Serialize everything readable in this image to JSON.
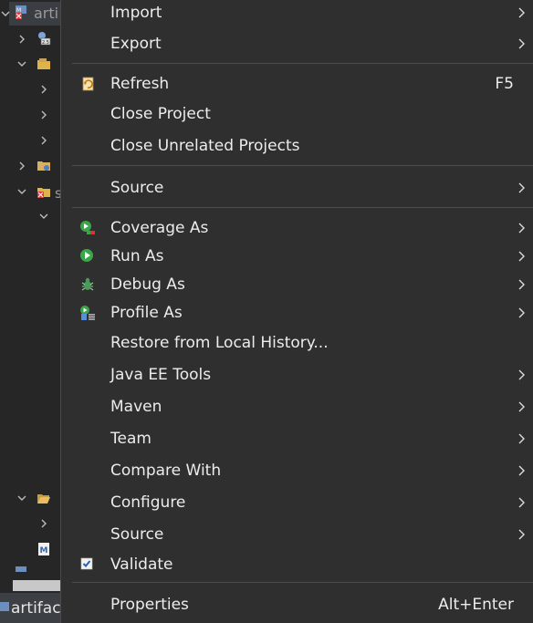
{
  "tree": {
    "rows": [
      {
        "label": "arti",
        "expanded": true
      },
      {
        "label": "",
        "expanded": false
      },
      {
        "label": "",
        "expanded": true
      },
      {
        "label": "",
        "expanded": false
      },
      {
        "label": "",
        "expanded": false
      },
      {
        "label": "",
        "expanded": false
      },
      {
        "label": "",
        "expanded": false
      },
      {
        "label": "",
        "expanded": true
      },
      {
        "label": "",
        "expanded": true
      },
      {
        "label": "",
        "expanded": true
      },
      {
        "label": "",
        "expanded": false
      }
    ],
    "status_label": "artifact"
  },
  "menu": {
    "items": [
      {
        "label": "Import",
        "accelerator": "",
        "submenu": true,
        "icon": ""
      },
      {
        "label": "Export",
        "accelerator": "",
        "submenu": true,
        "icon": ""
      },
      {
        "label": "Refresh",
        "accelerator": "F5",
        "submenu": false,
        "icon": "refresh-icon"
      },
      {
        "label": "Close Project",
        "accelerator": "",
        "submenu": false,
        "icon": ""
      },
      {
        "label": "Close Unrelated Projects",
        "accelerator": "",
        "submenu": false,
        "icon": ""
      },
      {
        "label": "Source",
        "accelerator": "",
        "submenu": true,
        "icon": ""
      },
      {
        "label": "Coverage As",
        "accelerator": "",
        "submenu": true,
        "icon": "coverage-icon"
      },
      {
        "label": "Run As",
        "accelerator": "",
        "submenu": true,
        "icon": "run-icon"
      },
      {
        "label": "Debug As",
        "accelerator": "",
        "submenu": true,
        "icon": "debug-bug-icon"
      },
      {
        "label": "Profile As",
        "accelerator": "",
        "submenu": true,
        "icon": "profile-icon"
      },
      {
        "label": "Restore from Local History...",
        "accelerator": "",
        "submenu": false,
        "icon": ""
      },
      {
        "label": "Java EE Tools",
        "accelerator": "",
        "submenu": true,
        "icon": ""
      },
      {
        "label": "Maven",
        "accelerator": "",
        "submenu": true,
        "icon": ""
      },
      {
        "label": "Team",
        "accelerator": "",
        "submenu": true,
        "icon": ""
      },
      {
        "label": "Compare With",
        "accelerator": "",
        "submenu": true,
        "icon": ""
      },
      {
        "label": "Configure",
        "accelerator": "",
        "submenu": true,
        "icon": ""
      },
      {
        "label": "Source",
        "accelerator": "",
        "submenu": true,
        "icon": ""
      },
      {
        "label": "Validate",
        "accelerator": "",
        "submenu": false,
        "icon": "checkbox-checked-icon"
      },
      {
        "label": "Properties",
        "accelerator": "Alt+Enter",
        "submenu": false,
        "icon": ""
      }
    ]
  },
  "colors": {
    "menu_bg": "#2f2f2f",
    "tree_bg": "#262626",
    "text": "#ececec",
    "separator": "#4c4c4c"
  }
}
